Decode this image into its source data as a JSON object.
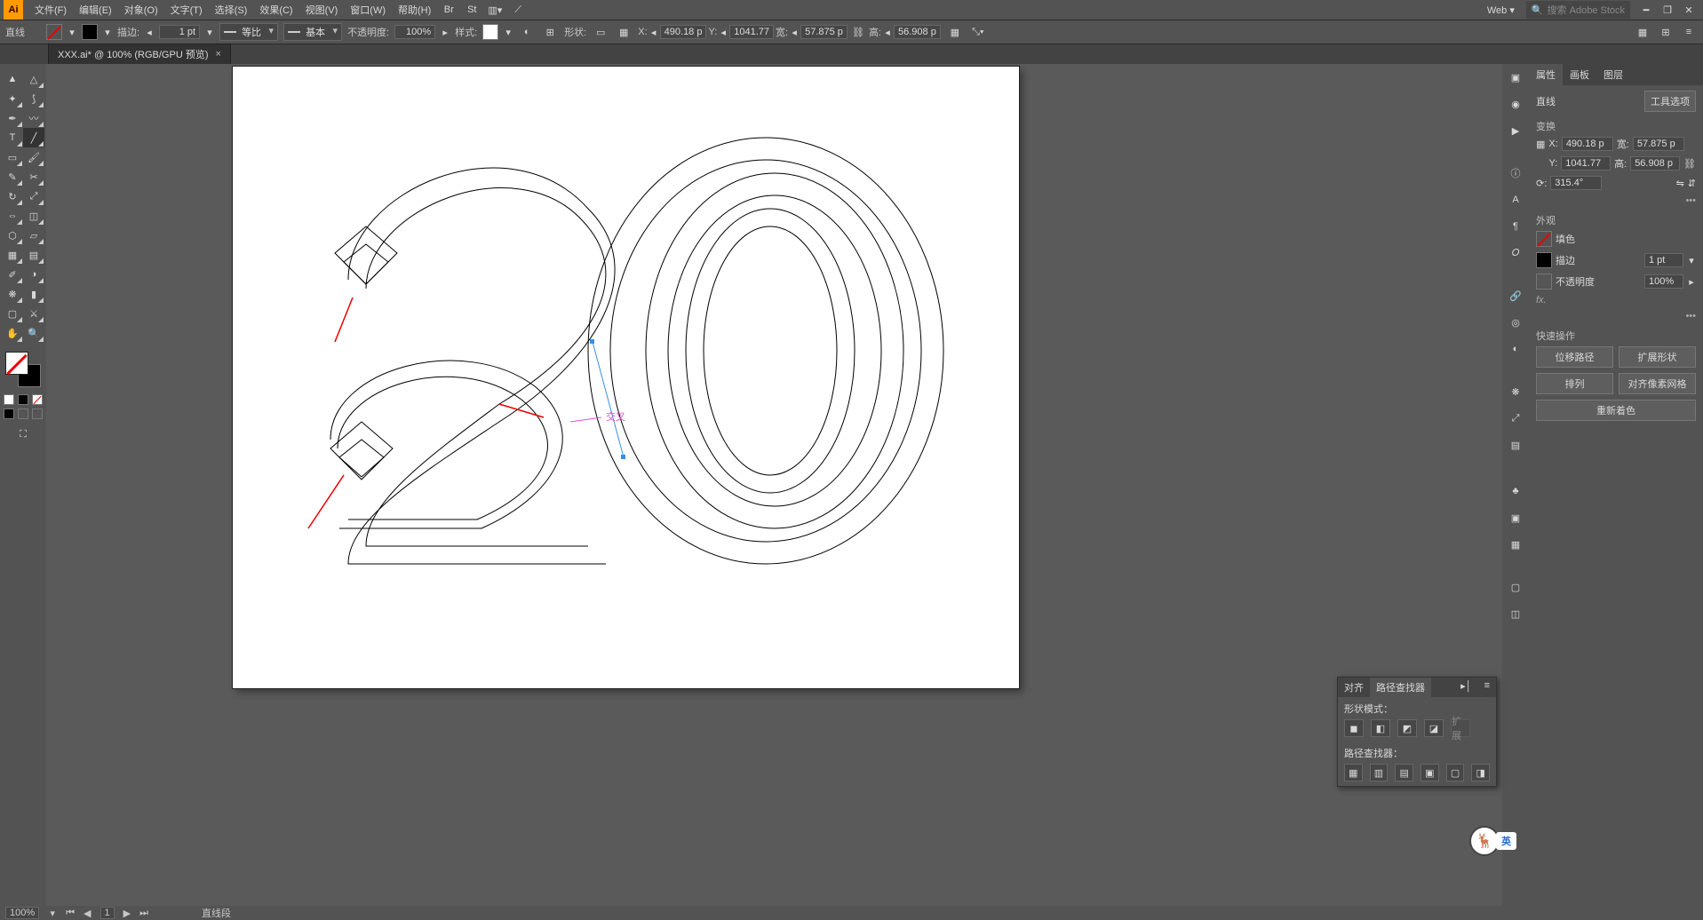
{
  "app": {
    "logo": "Ai"
  },
  "menu": {
    "items": [
      "文件(F)",
      "编辑(E)",
      "对象(O)",
      "文字(T)",
      "选择(S)",
      "效果(C)",
      "视图(V)",
      "窗口(W)",
      "帮助(H)"
    ],
    "workspace": "Web",
    "search_placeholder": "搜索 Adobe Stock"
  },
  "control": {
    "tool_label": "直线",
    "stroke_label": "描边:",
    "stroke_value": "1 pt",
    "profile1": "等比",
    "profile2": "基本",
    "opacity_label": "不透明度:",
    "opacity_value": "100%",
    "style_label": "样式:",
    "shape_label": "形状:",
    "coords": {
      "x_label": "X:",
      "x": "490.18 p",
      "y_label": "Y:",
      "y": "1041.77",
      "w_label": "宽:",
      "w": "57.875 p",
      "h_label": "高:",
      "h": "56.908 p"
    }
  },
  "document": {
    "tab_title": "XXX.ai* @ 100% (RGB/GPU 预览)"
  },
  "canvas": {
    "smart_guide": "交叉"
  },
  "float_panel": {
    "tab_align": "对齐",
    "tab_pathfinder": "路径查找器",
    "section_shape": "形状模式：",
    "section_path": "路径查找器："
  },
  "properties": {
    "tabs": [
      "属性",
      "画板",
      "图层"
    ],
    "obj_type": "直线",
    "tool_options": "工具选项",
    "sect_transform": "变换",
    "x_label": "X:",
    "x": "490.18 p",
    "y_label": "Y:",
    "y": "1041.77",
    "w_label": "宽:",
    "w": "57.875 p",
    "h_label": "高:",
    "h": "56.908 p",
    "angle_label": "⟳:",
    "angle": "315.4°",
    "sect_appearance": "外观",
    "fill_label": "填色",
    "stroke_label": "描边",
    "stroke_value": "1 pt",
    "opacity_label": "不透明度",
    "opacity_value": "100%",
    "fx_label": "fx.",
    "sect_quick": "快速操作",
    "quick_actions": [
      "位移路径",
      "扩展形状",
      "排列",
      "对齐像素网格",
      "重新着色"
    ]
  },
  "status": {
    "zoom": "100%",
    "artboard": "1",
    "mode": "直线段"
  },
  "ime": {
    "label": "英"
  }
}
